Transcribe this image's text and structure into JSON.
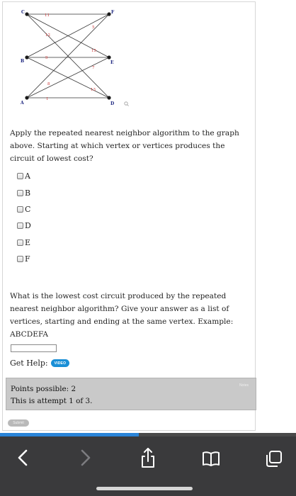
{
  "graph": {
    "vertices": [
      "A",
      "B",
      "C",
      "D",
      "E",
      "F"
    ],
    "edge_weights": [
      "11",
      "12",
      "5",
      "15",
      "9",
      "7",
      "8",
      "13",
      "1"
    ],
    "magnifier_icon": "search-icon"
  },
  "question1": {
    "prompt": "Apply the repeated nearest neighbor algorithm to the graph above. Starting at which vertex or vertices produces the circuit of lowest cost?",
    "options": [
      "A",
      "B",
      "C",
      "D",
      "E",
      "F"
    ]
  },
  "question2": {
    "prompt": "What is the lowest cost circuit produced by the repeated nearest neighbor algorithm? Give your answer as a list of vertices, starting and ending at the same vertex. Example: ABCDEFA",
    "answer_value": ""
  },
  "help": {
    "label": "Get Help:",
    "video_label": "VIDEO"
  },
  "points": {
    "possible": "Points possible: 2",
    "attempt": "This is attempt 1 of 3.",
    "corner": "Notes"
  },
  "submit_label": "Submit",
  "page_load_progress": 0.47,
  "colors": {
    "video_button": "#1a8fd6",
    "points_box": "#c9c9c9",
    "toolbar": "#3a3a3c",
    "progress_fill": "#2a84d8",
    "vertex": "#1a1a1a",
    "edge_label": "#cc3333"
  },
  "browser_toolbar": {
    "icons": [
      "back-arrow-icon",
      "forward-arrow-icon",
      "share-icon",
      "bookmarks-icon",
      "tabs-icon"
    ]
  }
}
